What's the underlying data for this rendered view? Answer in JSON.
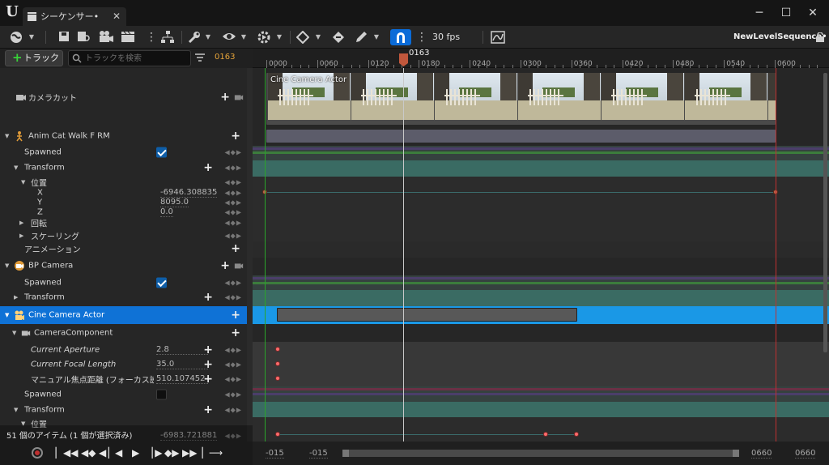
{
  "window": {
    "tab_title": "シーケンサー•",
    "sequence_name": "NewLevelSequence•",
    "fps": "30 fps",
    "controls": {
      "minimize": "─",
      "maximize": "☐",
      "close": "✕"
    }
  },
  "filter": {
    "add_track_label": "トラック",
    "search_placeholder": "トラックを検索",
    "current_frame": "0163"
  },
  "ruler": {
    "ticks": [
      "0000",
      "0060",
      "0120",
      "0180",
      "0240",
      "0300",
      "0360",
      "0420",
      "0480",
      "0540",
      "0600"
    ],
    "playhead_label": "0163",
    "playhead_frame": 163
  },
  "camera_cuts_label": "カメラカット",
  "camera_thumb_label": "Cine Camera Actor",
  "tracks": {
    "cat": {
      "label": "Anim Cat Walk F RM",
      "spawned": "Spawned",
      "transform": "Transform",
      "location": "位置",
      "x_label": "X",
      "x_value": "-6946.308835",
      "y_label": "Y",
      "y_value": "8095.0",
      "z_label": "Z",
      "z_value": "0.0",
      "rotation": "回転",
      "scale": "スケーリング",
      "animation": "アニメーション"
    },
    "bp": {
      "label": "BP Camera",
      "spawned": "Spawned",
      "transform": "Transform"
    },
    "cine": {
      "label": "Cine Camera Actor",
      "component": "CameraComponent",
      "aperture_label": "Current Aperture",
      "aperture_value": "2.8",
      "focal_label": "Current Focal Length",
      "focal_value": "35.0",
      "focus_label": "マニュアル焦点距離 (フォーカス設",
      "focus_value": "510.107452",
      "spawned": "Spawned",
      "transform": "Transform",
      "location": "位置",
      "x_value": "-6983.721881"
    }
  },
  "status": {
    "items_text": "51 個のアイテム (1 個が選択済み)"
  },
  "bottom_range": {
    "start_a": "-015",
    "start_b": "-015",
    "end_a": "0660",
    "end_b": "0660"
  },
  "colors": {
    "selection": "#0f72d6",
    "playhead": "#c0573c",
    "key": "#ff6b6b",
    "frame_readout": "#e5a339",
    "start_marker": "#2aa52a",
    "end_marker": "#c03030"
  }
}
